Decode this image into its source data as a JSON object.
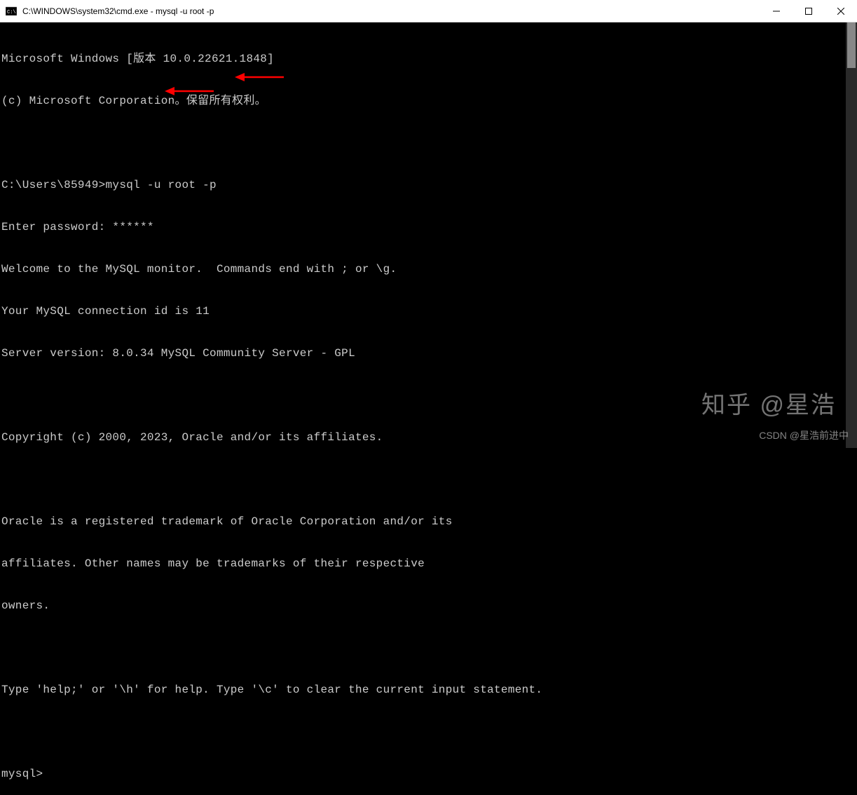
{
  "titlebar": {
    "title": "C:\\WINDOWS\\system32\\cmd.exe - mysql  -u root -p"
  },
  "terminal": {
    "lines": [
      "Microsoft Windows [版本 10.0.22621.1848]",
      "(c) Microsoft Corporation。保留所有权利。",
      "",
      "C:\\Users\\85949>mysql -u root -p",
      "Enter password: ******",
      "Welcome to the MySQL monitor.  Commands end with ; or \\g.",
      "Your MySQL connection id is 11",
      "Server version: 8.0.34 MySQL Community Server - GPL",
      "",
      "Copyright (c) 2000, 2023, Oracle and/or its affiliates.",
      "",
      "Oracle is a registered trademark of Oracle Corporation and/or its",
      "affiliates. Other names may be trademarks of their respective",
      "owners.",
      "",
      "Type 'help;' or '\\h' for help. Type '\\c' to clear the current input statement.",
      "",
      "mysql>"
    ]
  },
  "watermark": {
    "zhihu": "知乎 @星浩",
    "csdn": "CSDN @星浩前进中"
  }
}
